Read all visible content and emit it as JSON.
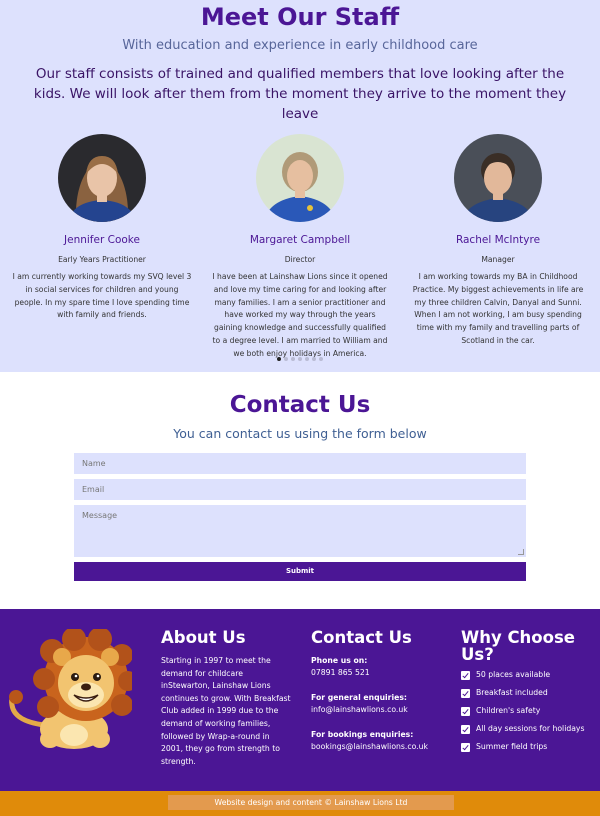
{
  "staff": {
    "title": "Meet Our Staff",
    "subtitle": "With education and experience in early childhood care",
    "intro": "Our staff consists of trained and qualified members that love looking after the kids. We will look after them from the moment they arrive to the moment they leave",
    "members": [
      {
        "name": "Jennifer Cooke",
        "role": "Early Years Practitioner",
        "bio": "I am currently working towards my SVQ level 3 in social services for children and young people. In my spare time I love spending time with family and friends."
      },
      {
        "name": "Margaret Campbell",
        "role": "Director",
        "bio": "I have been at Lainshaw Lions since it opened and love my time caring for and looking after many families. I am a senior practitioner and have worked my way through the years gaining knowledge and successfully qualified to a degree level. I am married to William and we both enjoy holidays in America."
      },
      {
        "name": "Rachel McIntyre",
        "role": "Manager",
        "bio": "I am working towards my BA in Childhood Practice. My biggest achievements in life are my three children Calvin, Danyal and Sunni. When I am not working, I am busy spending time with my family and travelling parts of Scotland in the car."
      }
    ],
    "carousel": {
      "pages": 7,
      "active_page": 1
    }
  },
  "contact": {
    "title": "Contact Us",
    "subtitle": "You can contact us using the form below",
    "form": {
      "name_placeholder": "Name",
      "email_placeholder": "Email",
      "message_placeholder": "Message",
      "submit_label": "Submit"
    }
  },
  "footer": {
    "about": {
      "heading": "About Us",
      "text": "Starting in 1997 to meet the demand for childcare inStewarton, Lainshaw Lions continues to grow. With Breakfast Club added in 1999 due to the demand of working families, followed by Wrap-a-round in 2001, they go from strength to strength."
    },
    "contact": {
      "heading": "Contact Us",
      "phone_label": "Phone us on:",
      "phone": "07891 865 521",
      "general_label": "For general enquiries:",
      "general_email": "info@lainshawlions.co.uk",
      "bookings_label": "For bookings enquiries:",
      "bookings_email": "bookings@lainshawlions.co.uk"
    },
    "why": {
      "heading": "Why Choose Us?",
      "items": [
        "50 places available",
        "Breakfast included",
        "Children's safety",
        "All day sessions for holidays",
        "Summer field trips"
      ]
    },
    "copyright": "Website design and content © Lainshaw Lions Ltd"
  },
  "colors": {
    "brand_purple": "#4b1695",
    "light_lavender": "#dde1fd",
    "footer_orange": "#e08b0a"
  },
  "icons": [
    "lion-logo-icon",
    "checkbox-checked-icon"
  ]
}
